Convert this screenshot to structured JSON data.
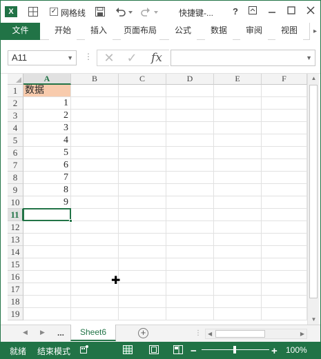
{
  "titlebar": {
    "app_icon": "excel-logo-icon",
    "gridlines_checked": true,
    "gridlines_label": "网格线",
    "doc_title": "快捷键-...",
    "help": "?",
    "window_buttons": [
      "help-icon",
      "ribbon-display-icon",
      "minimize-icon",
      "maximize-icon",
      "close-icon"
    ]
  },
  "ribbon": {
    "tabs": [
      "文件",
      "开始",
      "插入",
      "页面布局",
      "公式",
      "数据",
      "审阅",
      "视图"
    ],
    "accent": "#217346"
  },
  "formula_bar": {
    "name_box": "A11",
    "formula": ""
  },
  "grid": {
    "columns": [
      "A",
      "B",
      "C",
      "D",
      "E",
      "F"
    ],
    "rows": [
      "1",
      "2",
      "3",
      "4",
      "5",
      "6",
      "7",
      "8",
      "9",
      "10",
      "11",
      "12",
      "13",
      "14",
      "15",
      "16",
      "17",
      "18",
      "19"
    ],
    "cells": {
      "A1": "数据",
      "A2": "1",
      "A3": "2",
      "A4": "3",
      "A5": "4",
      "A6": "5",
      "A7": "6",
      "A8": "7",
      "A9": "8",
      "A10": "9"
    },
    "header_fill_color": "#f8cbad",
    "selected_cell": "A11"
  },
  "sheets": {
    "more": "...",
    "active": "Sheet6"
  },
  "statusbar": {
    "ready": "就绪",
    "mode": "结束模式",
    "zoom": "100%"
  }
}
